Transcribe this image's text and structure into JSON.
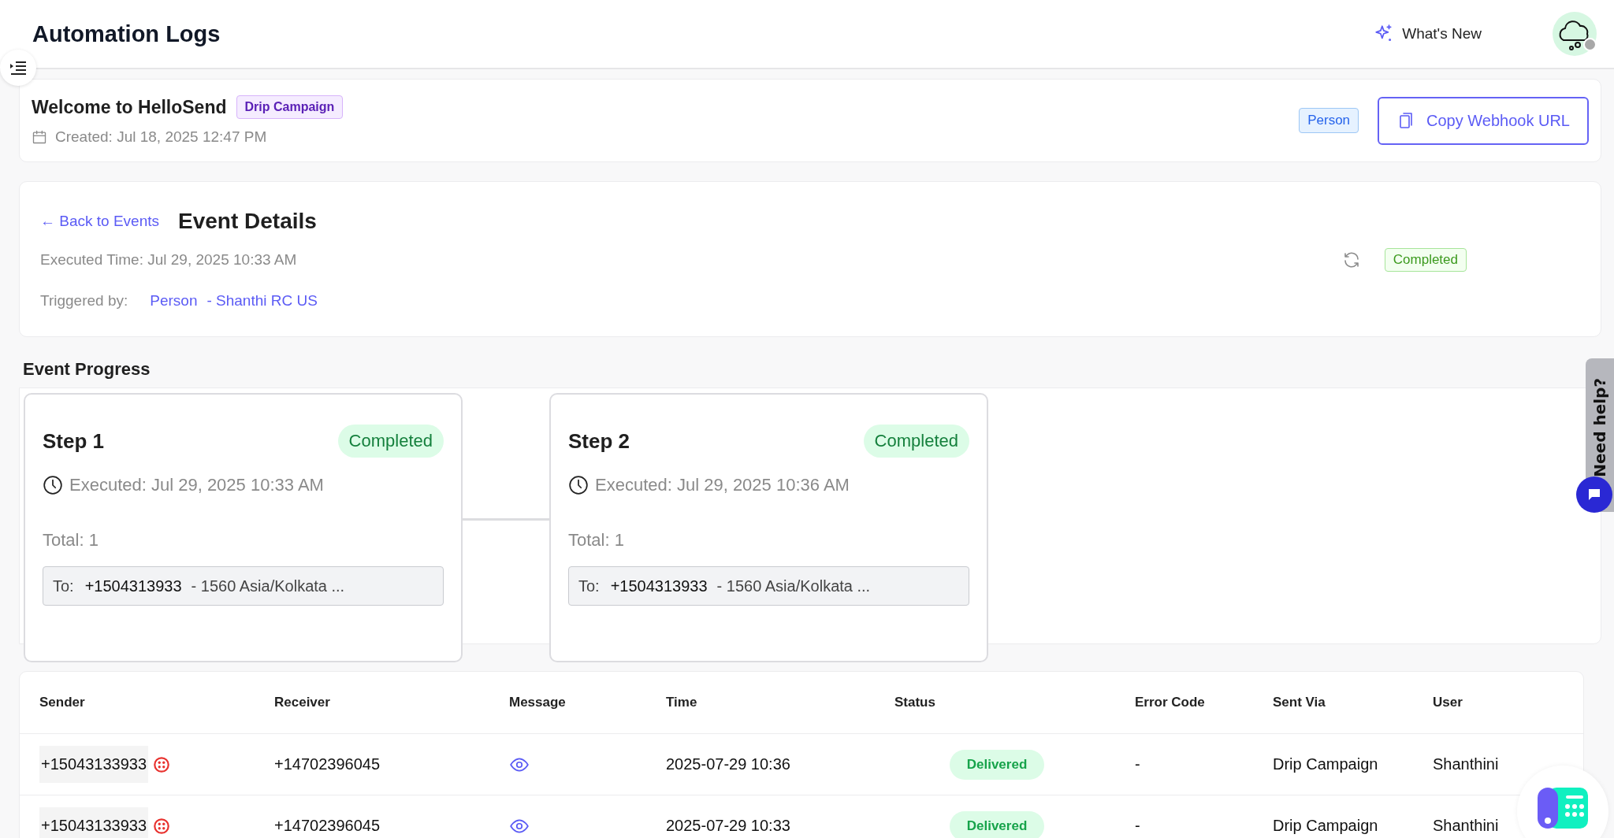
{
  "header": {
    "title": "Automation Logs",
    "whats_new": "What's New"
  },
  "automation": {
    "name": "Welcome to HelloSend",
    "type_badge": "Drip Campaign",
    "created": "Created: Jul 18, 2025 12:47 PM",
    "trigger_badge": "Person",
    "copy_button": "Copy Webhook URL"
  },
  "event": {
    "back_link": "← Back to Events",
    "title": "Event Details",
    "executed": "Executed Time: Jul 29, 2025 10:33 AM",
    "triggered_label": "Triggered by:",
    "triggered_type": "Person",
    "triggered_name": "- Shanthi RC US",
    "status": "Completed"
  },
  "progress": {
    "title": "Event Progress",
    "steps": [
      {
        "title": "Step 1",
        "status": "Completed",
        "executed": "Executed: Jul 29, 2025 10:33 AM",
        "total": "Total: 1",
        "to_label": "To:",
        "to_number": "+1504313933",
        "to_detail": "- 1560 Asia/Kolkata ..."
      },
      {
        "title": "Step 2",
        "status": "Completed",
        "executed": "Executed: Jul 29, 2025 10:36 AM",
        "total": "Total: 1",
        "to_label": "To:",
        "to_number": "+1504313933",
        "to_detail": "- 1560 Asia/Kolkata ..."
      }
    ]
  },
  "table": {
    "columns": [
      "Sender",
      "Receiver",
      "Message",
      "Time",
      "Status",
      "Error Code",
      "Sent Via",
      "User"
    ],
    "rows": [
      {
        "sender": "+15043133933",
        "receiver": "+14702396045",
        "time": "2025-07-29 10:36",
        "status": "Delivered",
        "error_code": "-",
        "sent_via": "Drip Campaign",
        "user": "Shanthini"
      },
      {
        "sender": "+15043133933",
        "receiver": "+14702396045",
        "time": "2025-07-29 10:33",
        "status": "Delivered",
        "error_code": "-",
        "sent_via": "Drip Campaign",
        "user": "Shanthini"
      }
    ]
  },
  "help_tab": {
    "label": "Need help?"
  }
}
